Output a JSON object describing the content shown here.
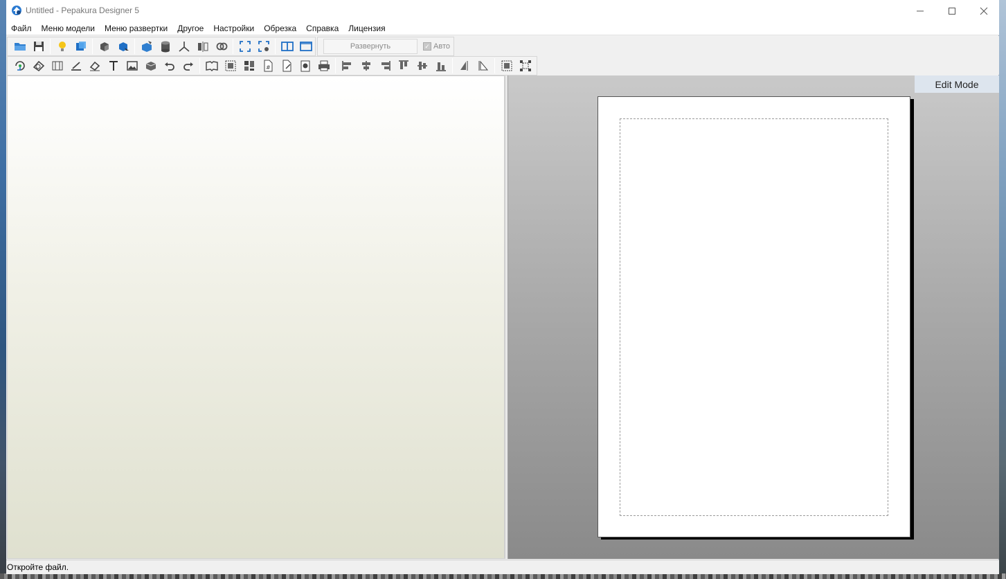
{
  "window": {
    "title": "Untitled - Pepakura Designer 5",
    "controls": {
      "minimize": "—",
      "maximize": "☐",
      "close": "✕"
    }
  },
  "menu": {
    "items": [
      "Файл",
      "Меню модели",
      "Меню развертки",
      "Другое",
      "Настройки",
      "Обрезка",
      "Справка",
      "Лицензия"
    ]
  },
  "toolbar1": {
    "unfold_label": "Развернуть",
    "auto_label": "Авто",
    "auto_checked": true
  },
  "view2d": {
    "mode_label": "Edit Mode"
  },
  "status": {
    "text": "Откройте файл."
  },
  "colors": {
    "accent_blue": "#1f6fc5",
    "edit_mode_bg": "#dde5ee",
    "toolbar_bg": "#f0f0f0"
  },
  "icons": {
    "toolbar1": [
      "open-folder-icon",
      "save-icon",
      "lightbulb-icon",
      "texture-icon",
      "select-face-icon",
      "select-face-move-icon",
      "cube-paint-icon",
      "cylinder-icon",
      "axis-icon",
      "mirror-icon",
      "link-icon",
      "fit-view-icon",
      "fit-settings-icon",
      "split-view-icon",
      "single-view-icon"
    ],
    "toolbar2": [
      "rotate-icon",
      "join-icon",
      "edge-edit-icon",
      "line-icon",
      "eraser-icon",
      "text-icon",
      "image-icon",
      "box-icon",
      "undo-icon",
      "redo-icon",
      "unfold-book-icon",
      "select-parts-icon",
      "arrange-parts-icon",
      "page-number-icon",
      "page-edit-icon",
      "print-preview-icon",
      "printer-icon",
      "align-left-icon",
      "align-center-h-icon",
      "align-right-icon",
      "align-top-icon",
      "align-middle-v-icon",
      "align-bottom-icon",
      "flip-h-icon",
      "flip-v-icon",
      "group-icon",
      "ungroup-icon"
    ]
  }
}
